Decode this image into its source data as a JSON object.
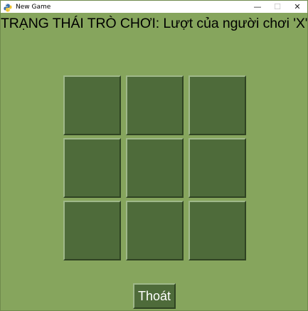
{
  "window": {
    "title": "New Game",
    "icon": "python-icon",
    "controls": {
      "minimize": "—",
      "maximize": "☐",
      "close": "✕"
    }
  },
  "status_text": "TRẠNG THÁI TRÒ CHƠI: Lượt của người chơi 'X'",
  "board": {
    "cells": [
      "",
      "",
      "",
      "",
      "",
      "",
      "",
      "",
      ""
    ]
  },
  "exit_button_label": "Thoát",
  "colors": {
    "background": "#86a55d",
    "cell": "#4e6b3a",
    "button_text": "#ffffff"
  }
}
